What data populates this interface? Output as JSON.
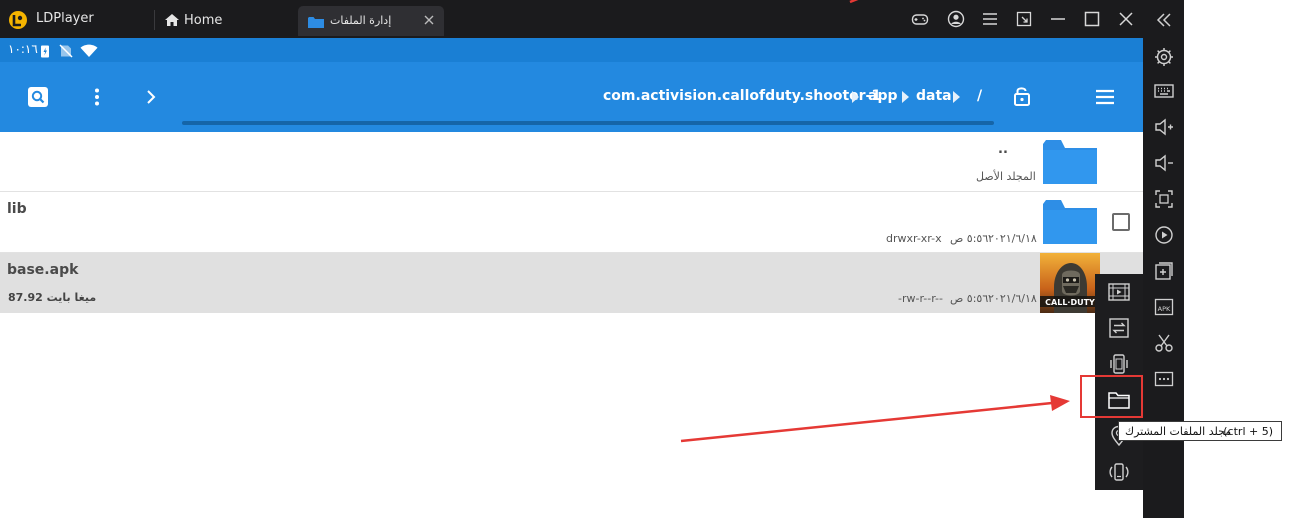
{
  "titlebar": {
    "app_name": "LDPlayer",
    "home_tab_label": "Home",
    "active_tab_label": "إدارة الملفات"
  },
  "status_bar": {
    "time": "١٠:١٦"
  },
  "app_bar": {
    "path_segments": [
      "com.activision.callofduty.shooter-1",
      "app",
      "data",
      "/"
    ]
  },
  "files": [
    {
      "name": "..",
      "subtitle": "المجلد الأصل"
    },
    {
      "name": "lib",
      "date": "٢٠٢١/٦/١٨",
      "time": "٥:٥٦ ص",
      "permissions": "drwxr-xr-x"
    },
    {
      "name": "base.apk",
      "size": "87.92 ميغا بايت",
      "date": "٢٠٢١/٦/١٨",
      "time": "٥:٥٦ ص",
      "permissions": "-rw-r--r--",
      "thumbnail_text": "CALL·DUTY"
    }
  ],
  "tooltip": {
    "label": "مجلد الملفات المشترك",
    "shortcut": "(ctrl + 5)"
  },
  "colors": {
    "status_bar": "#1a7fd4",
    "app_bar": "#2389e0",
    "emulator_chrome": "#1b1b1d",
    "highlight": "#e53935"
  },
  "icons": {
    "right_toolbar": [
      "collapse-icon",
      "settings-icon",
      "keyboard-icon",
      "volume-up-icon",
      "volume-down-icon",
      "screen-fit-icon",
      "record-icon",
      "add-window-icon",
      "apk-icon",
      "scissors-icon",
      "more-icon"
    ],
    "sub_toolbar": [
      "video-icon",
      "sync-icon",
      "shake-icon",
      "shared-folder-icon",
      "location-icon",
      "rotate-icon"
    ]
  }
}
